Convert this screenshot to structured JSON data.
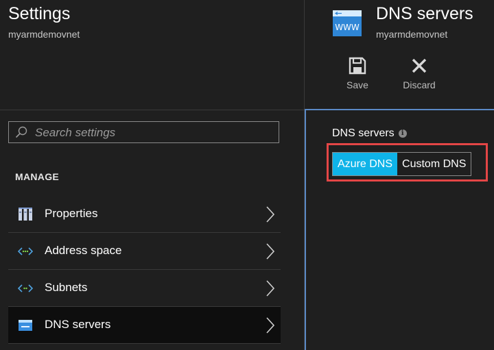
{
  "settings_blade": {
    "title": "Settings",
    "subtitle": "myarmdemovnet",
    "search": {
      "placeholder": "Search settings"
    },
    "section_label": "MANAGE",
    "menu": [
      {
        "label": "Properties",
        "icon": "properties-icon"
      },
      {
        "label": "Address space",
        "icon": "address-space-icon"
      },
      {
        "label": "Subnets",
        "icon": "subnets-icon"
      },
      {
        "label": "DNS servers",
        "icon": "dns-servers-icon",
        "selected": true
      }
    ]
  },
  "dns_blade": {
    "title": "DNS servers",
    "subtitle": "myarmdemovnet",
    "icon": "www-icon",
    "commands": {
      "save_label": "Save",
      "discard_label": "Discard"
    },
    "field_label": "DNS servers",
    "toggle": {
      "options": [
        "Azure DNS",
        "Custom DNS"
      ],
      "selected": "Azure DNS"
    }
  },
  "colors": {
    "background": "#1f1f1f",
    "accent": "#0fb3e8",
    "highlight": "#e44646",
    "active_border": "#5b8ac7"
  }
}
